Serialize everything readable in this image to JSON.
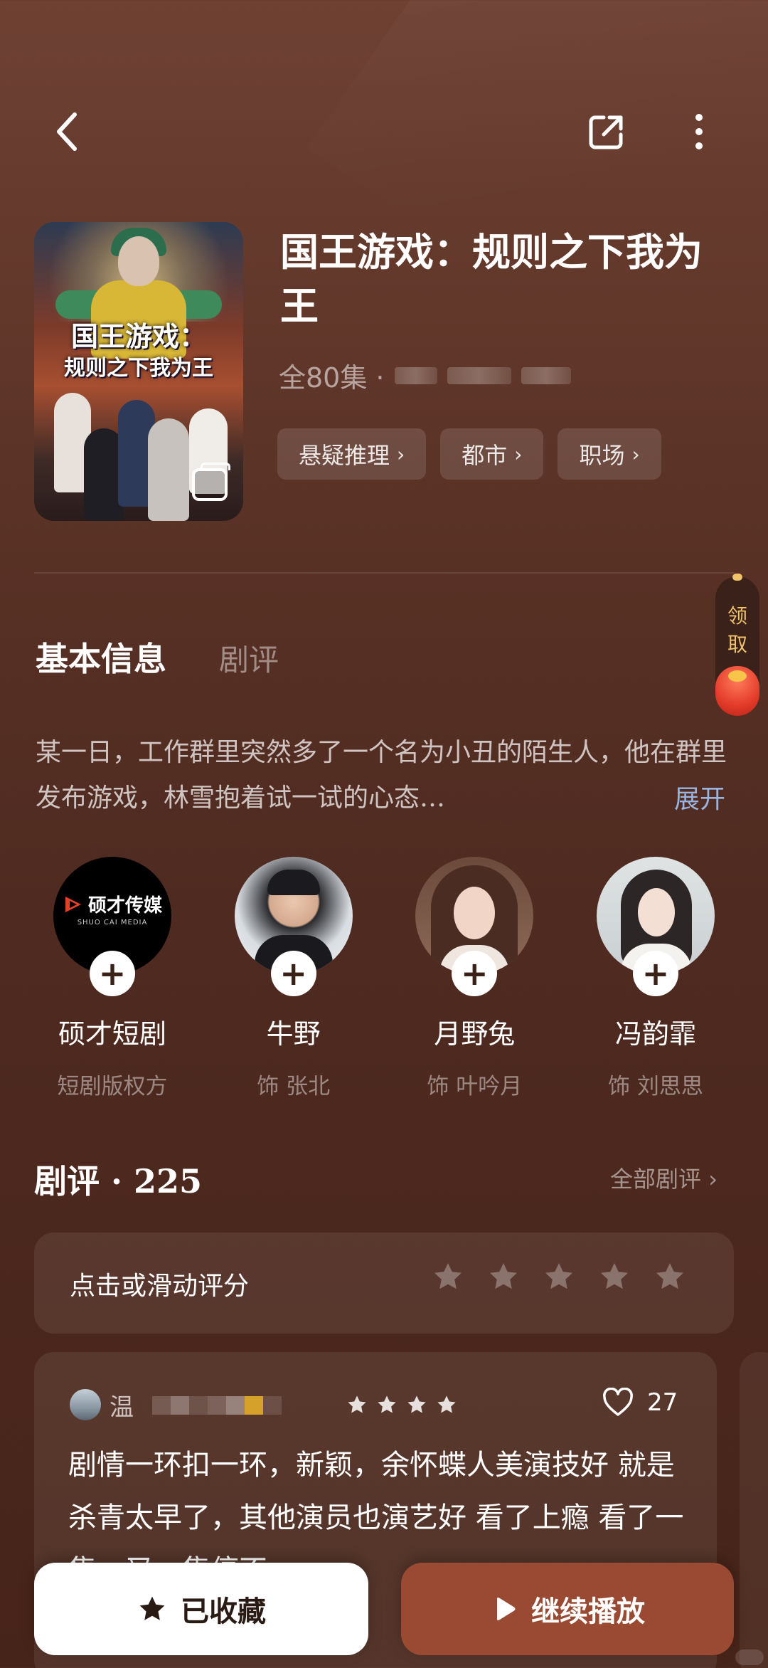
{
  "header": {
    "title": "国王游戏：规则之下我为王",
    "episodes": "全80集 · "
  },
  "poster": {
    "line1": "国王游戏：",
    "line2": "规则之下我为王"
  },
  "tags": [
    {
      "label": "悬疑推理"
    },
    {
      "label": "都市"
    },
    {
      "label": "职场"
    }
  ],
  "reward": {
    "label": "领取"
  },
  "tabs": {
    "active": "基本信息",
    "inactive": "剧评"
  },
  "synopsis": {
    "text": "某一日，工作群里突然多了一个名为小丑的陌生人，他在群里发布游戏，林雪抱着试一试的心态…",
    "expand": "展开"
  },
  "cast": [
    {
      "name": "硕才短剧",
      "role": "短剧版权方",
      "logo_main": "硕才传媒",
      "logo_sub": "SHUO CAI MEDIA"
    },
    {
      "name": "牛野",
      "role": "饰 张北"
    },
    {
      "name": "月野兔",
      "role": "饰 叶吟月"
    },
    {
      "name": "冯韵霏",
      "role": "饰 刘思思"
    }
  ],
  "reviews": {
    "title": "剧评 · 225",
    "all_label": "全部剧评",
    "rate_prompt": "点击或滑动评分",
    "rating_stars_total": 5,
    "items": [
      {
        "user_prefix": "温",
        "stars": 4,
        "likes": "27",
        "text": "剧情一环扣一环，新颖，余怀蝶人美演技好 就是杀青太早了，其他演员也演艺好 看了上瘾 看了一集，又一集停不"
      }
    ]
  },
  "bottom": {
    "favorite_label": "已收藏",
    "play_label": "继续播放"
  },
  "colors": {
    "background": "#5a3226",
    "play_button": "#9a4a32",
    "expand_link": "#9ab4de",
    "reward_text": "#f1c36a"
  },
  "icons": [
    "back-arrow-icon",
    "share-icon",
    "more-vertical-icon",
    "chevron-right-icon",
    "plus-icon",
    "star-icon",
    "heart-icon",
    "play-icon",
    "stack-icon"
  ]
}
